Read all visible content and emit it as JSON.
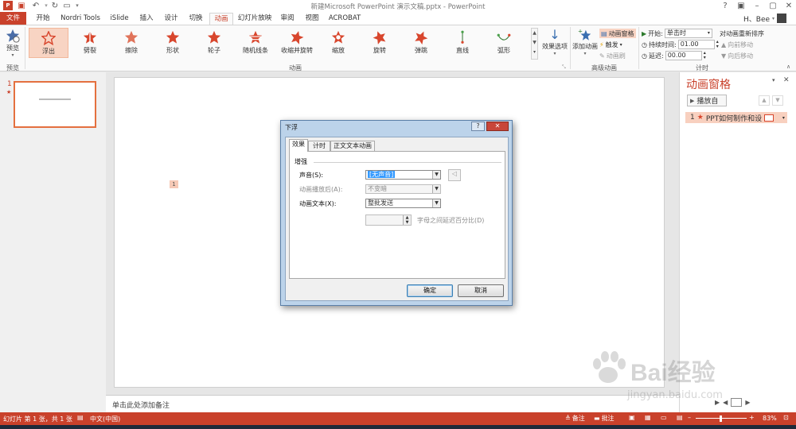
{
  "window": {
    "title": "新建Microsoft PowerPoint 演示文稿.pptx - PowerPoint",
    "user": "H、Bee"
  },
  "tabs": [
    {
      "label": "文件",
      "kind": "file"
    },
    {
      "label": "开始"
    },
    {
      "label": "Nordri Tools"
    },
    {
      "label": "iSlide"
    },
    {
      "label": "插入"
    },
    {
      "label": "设计"
    },
    {
      "label": "切换"
    },
    {
      "label": "动画",
      "active": true
    },
    {
      "label": "幻灯片放映"
    },
    {
      "label": "审阅"
    },
    {
      "label": "视图"
    },
    {
      "label": "ACROBAT"
    }
  ],
  "ribbon": {
    "preview": {
      "label": "预览",
      "group": "预览"
    },
    "animations": [
      "浮出",
      "劈裂",
      "擦除",
      "形状",
      "轮子",
      "随机线条",
      "收缩并旋转",
      "缩放",
      "旋转",
      "弹跳",
      "直线",
      "弧形"
    ],
    "animations_group": "动画",
    "effect_options": "效果选项",
    "add_animation": "添加动画",
    "advanced": {
      "pane": "动画窗格",
      "trigger": "触发",
      "painter": "动画刷",
      "group": "高级动画"
    },
    "timing": {
      "start_label": "开始:",
      "start_value": "单击时",
      "duration_label": "持续时间:",
      "duration_value": "01.00",
      "delay_label": "延迟:",
      "delay_value": "00.00",
      "reorder": "对动画重新排序",
      "move_earlier": "向前移动",
      "move_later": "向后移动",
      "group": "计时"
    },
    "accent": "#c9412b"
  },
  "slides": [
    {
      "number": "1"
    }
  ],
  "slide_tag": "1",
  "notes_placeholder": "单击此处添加备注",
  "anim_pane": {
    "title": "动画窗格",
    "play": "播放自",
    "item_index": "1",
    "item_label": "PPT如何制作和设..."
  },
  "status": {
    "slide_info": "幻灯片 第 1 张，共 1 张",
    "language": "中文(中国)",
    "notes": "备注",
    "comments": "批注",
    "zoom": "83%"
  },
  "dialog": {
    "title": "下浮",
    "tabs": [
      "效果",
      "计时",
      "正文文本动画"
    ],
    "section": "增强",
    "sound_label": "声音(S):",
    "sound_value": "[无声音]",
    "after_label": "动画播放后(A):",
    "after_value": "不变暗",
    "text_label": "动画文本(X):",
    "text_value": "整批发送",
    "delay_suffix": "字母之间延迟百分比(D)",
    "ok": "确定",
    "cancel": "取消"
  },
  "watermark": {
    "brand": "Bai经验",
    "url": "jingyan.baidu.com"
  }
}
